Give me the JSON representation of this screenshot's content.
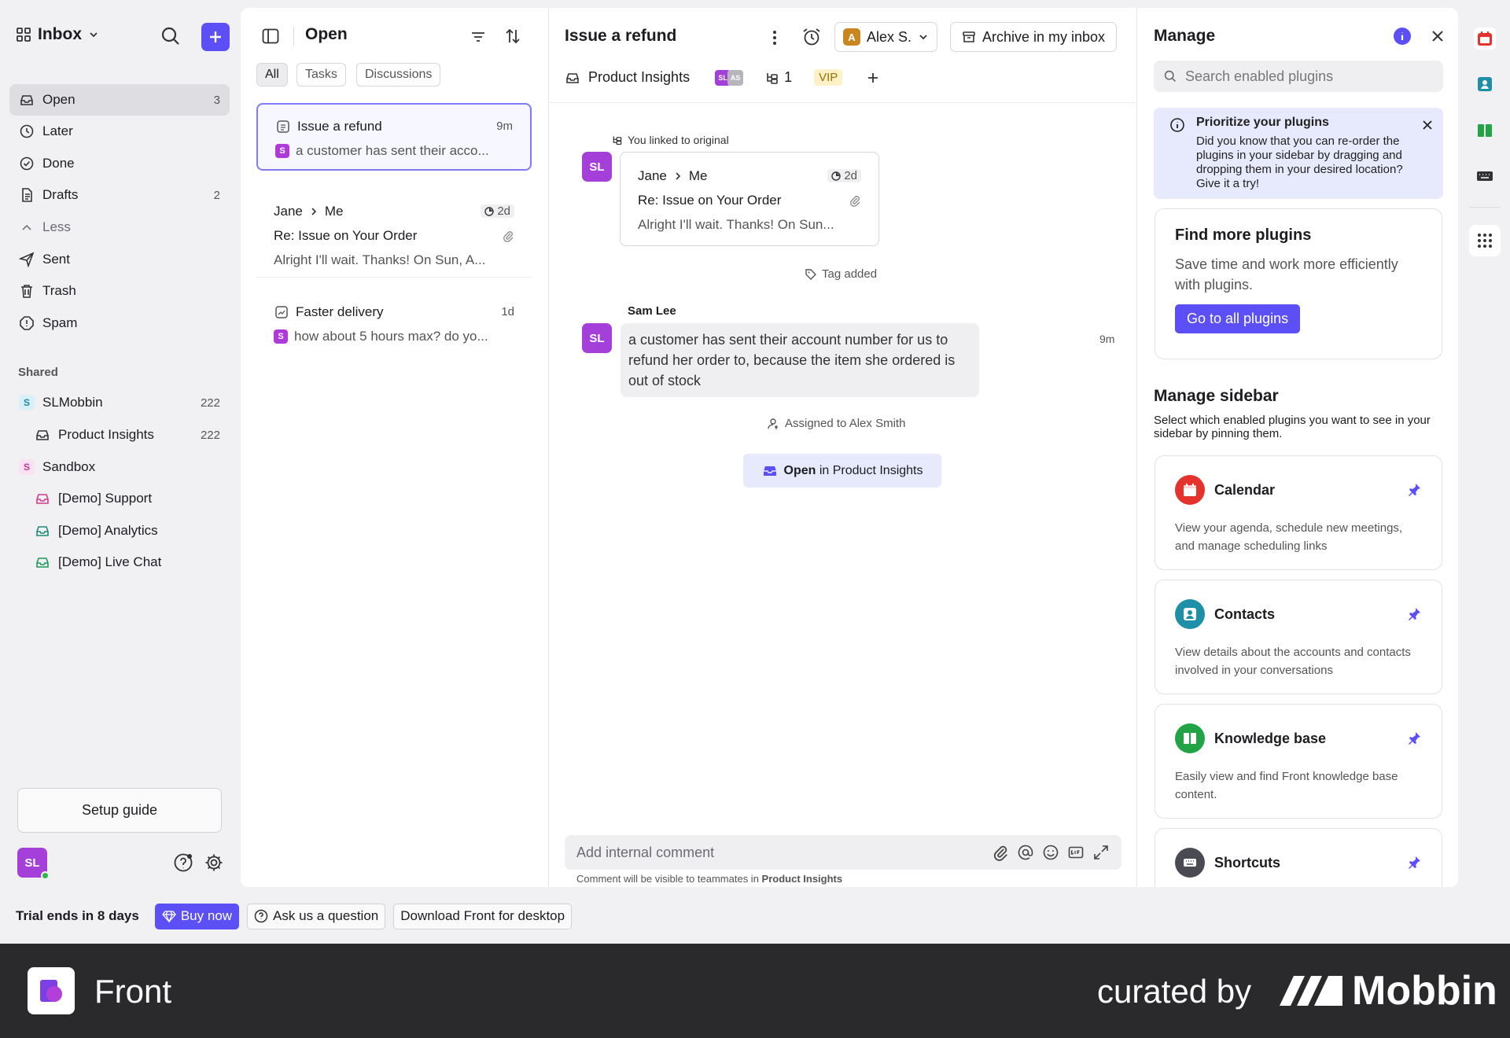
{
  "sidebar": {
    "workspace": "Inbox",
    "nav": [
      {
        "label": "Open",
        "count": "3"
      },
      {
        "label": "Later",
        "count": ""
      },
      {
        "label": "Done",
        "count": ""
      },
      {
        "label": "Drafts",
        "count": "2"
      },
      {
        "label": "Less",
        "count": ""
      },
      {
        "label": "Sent",
        "count": ""
      },
      {
        "label": "Trash",
        "count": ""
      },
      {
        "label": "Spam",
        "count": ""
      }
    ],
    "shared_title": "Shared",
    "shared": [
      {
        "label": "SLMobbin",
        "count": "222",
        "badge": "S"
      },
      {
        "label": "Product Insights",
        "count": "222"
      },
      {
        "label": "Sandbox",
        "count": "",
        "badge": "S"
      },
      {
        "label": "[Demo] Support",
        "count": ""
      },
      {
        "label": "[Demo] Analytics",
        "count": ""
      },
      {
        "label": "[Demo] Live Chat",
        "count": ""
      }
    ],
    "setup_guide": "Setup guide",
    "avatar": "SL"
  },
  "list": {
    "title": "Open",
    "filters": [
      "All",
      "Tasks",
      "Discussions"
    ],
    "conversations": [
      {
        "title": "Issue a refund",
        "time": "9m",
        "badge": "S",
        "preview": "a customer has sent their acco..."
      },
      {
        "title": "Jane",
        "to": "Me",
        "time": "2d",
        "subject": "Re: Issue on Your Order",
        "preview": "Alright I'll wait. Thanks! On Sun, A..."
      },
      {
        "title": "Faster delivery",
        "time": "1d",
        "badge": "S",
        "preview": "how about 5 hours max? do yo..."
      }
    ]
  },
  "conversation": {
    "title": "Issue a refund",
    "assignee": "Alex S.",
    "assignee_initial": "A",
    "archive": "Archive in my inbox",
    "inbox": "Product Insights",
    "avatars": [
      "SL",
      "AS"
    ],
    "link_count": "1",
    "tag": "VIP",
    "linked_note": "You linked to original",
    "linked_card": {
      "from": "Jane",
      "to": "Me",
      "time": "2d",
      "subject": "Re: Issue on Your Order",
      "preview": "Alright I'll wait. Thanks! On Sun..."
    },
    "tag_added": "Tag added",
    "message": {
      "author": "Sam Lee",
      "avatar": "SL",
      "time": "9m",
      "text": "a customer has sent their account number for us to refund her order to, because the item she ordered is out of stock"
    },
    "assigned_note": "Assigned to Alex Smith",
    "open_in": {
      "strong": "Open",
      "rest": "in Product Insights"
    },
    "composer_placeholder": "Add internal comment",
    "composer_note": "Comment will be visible to teammates in",
    "composer_note_inbox": "Product Insights"
  },
  "manage": {
    "title": "Manage",
    "search_placeholder": "Search enabled plugins",
    "tip": {
      "title": "Prioritize your plugins",
      "body": "Did you know that you can re-order the plugins in your sidebar by dragging and dropping them in your desired location? Give it a try!"
    },
    "find_more": {
      "title": "Find more plugins",
      "body": "Save time and work more efficiently with plugins.",
      "button": "Go to all plugins"
    },
    "sidebar_title": "Manage sidebar",
    "sidebar_desc": "Select which enabled plugins you want to see in your sidebar by pinning them.",
    "plugins": [
      {
        "name": "Calendar",
        "desc": "View your agenda, schedule new meetings, and manage scheduling links",
        "icon": "calendar-icon",
        "color": "#e5322d"
      },
      {
        "name": "Contacts",
        "desc": "View details about the accounts and contacts involved in your conversations",
        "icon": "contacts-icon",
        "color": "#1d8fa6"
      },
      {
        "name": "Knowledge base",
        "desc": "Easily view and find Front knowledge base content.",
        "icon": "book-icon",
        "color": "#21a346"
      },
      {
        "name": "Shortcuts",
        "desc": "",
        "icon": "keyboard-icon",
        "color": "#4a4a52"
      }
    ]
  },
  "trial": {
    "text": "Trial ends in 8 days",
    "buy": "Buy now",
    "ask": "Ask us a question",
    "download": "Download Front for desktop"
  },
  "footer": {
    "app": "Front",
    "curated": "curated by",
    "brand": "Mobbin"
  },
  "colors": {
    "accent": "#5b4ff5",
    "badge_purple": "#a43fd9",
    "vip_bg": "#fff1c7"
  }
}
